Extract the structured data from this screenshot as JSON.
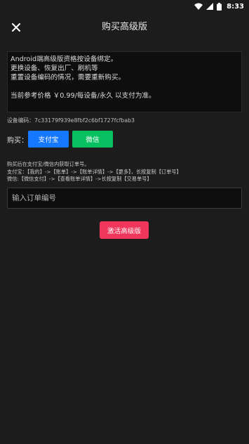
{
  "status_bar": {
    "time": "8:33",
    "icons": [
      "wifi-icon",
      "signal-icon",
      "battery-icon"
    ]
  },
  "header": {
    "title": "购买高级版",
    "close_icon": "close-icon"
  },
  "info": {
    "lines": [
      "Android端高级版资格按设备绑定。",
      "更换设备、恢复出厂、刷机等",
      "重置设备编码的情况，需要重新购买。",
      "当前参考价格 ￥0.99/每设备/永久 以支付为准。"
    ]
  },
  "device_code": "设备编码：7c33179f939e8fbf2c6bf1727fcfbab3",
  "purchase": {
    "label": "购买：",
    "alipay_label": "支付宝",
    "wechat_label": "微信"
  },
  "instructions": {
    "lines": [
      "购买后在支付宝/微信内获取订单号。",
      "支付宝：【我的】->【账单】->【账单详情】->【更多】，长按复制【订单号】",
      "微信:【微信支付】->【查看账单详情】->长按复制【交易单号】"
    ]
  },
  "order_input": {
    "placeholder": "输入订单编号",
    "value": ""
  },
  "activate_label": "激活高级版",
  "colors": {
    "background": "#1c1c1c",
    "alipay": "#1677ff",
    "wechat": "#07c160",
    "activate": "#f0365b"
  }
}
